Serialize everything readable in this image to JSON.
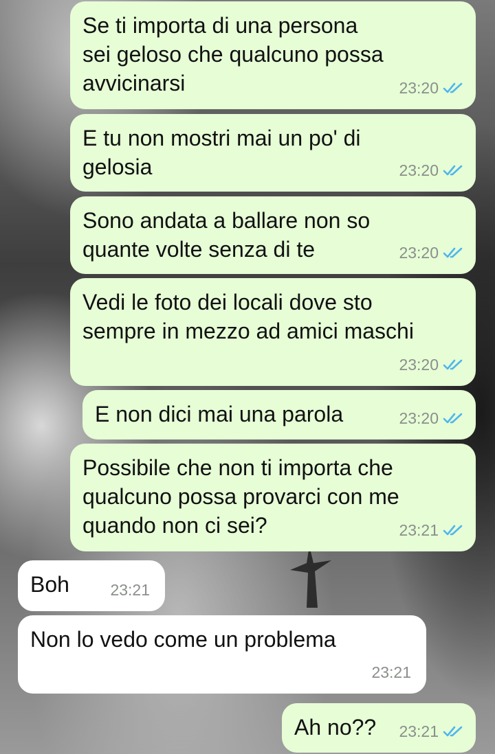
{
  "messages": [
    {
      "direction": "outgoing",
      "text": "Se ti importa di una persona\nsei geloso che qualcuno possa\navvicinarsi",
      "time": "23:20",
      "status_icon": "double-check-read-icon"
    },
    {
      "direction": "outgoing",
      "text": "E tu non mostri mai un po' di\ngelosia",
      "time": "23:20",
      "status_icon": "double-check-read-icon"
    },
    {
      "direction": "outgoing",
      "text": "Sono andata a ballare non so\nquante volte senza di te",
      "time": "23:20",
      "status_icon": "double-check-read-icon"
    },
    {
      "direction": "outgoing",
      "text": "Vedi le foto dei locali dove sto\nsempre in mezzo ad amici maschi",
      "time": "23:20",
      "status_icon": "double-check-read-icon"
    },
    {
      "direction": "outgoing",
      "text": "E non dici mai una parola",
      "time": "23:20",
      "status_icon": "double-check-read-icon"
    },
    {
      "direction": "outgoing",
      "text": "Possibile che non ti importa che\nqualcuno possa provarci con me\nquando non ci sei?",
      "time": "23:21",
      "status_icon": "double-check-read-icon"
    },
    {
      "direction": "incoming",
      "text": "Boh",
      "time": "23:21"
    },
    {
      "direction": "incoming",
      "text": "Non lo vedo come un problema",
      "time": "23:21"
    },
    {
      "direction": "outgoing",
      "text": "Ah no??",
      "time": "23:21",
      "status_icon": "double-check-read-icon"
    }
  ],
  "colors": {
    "outgoing_bubble": "#e6fdd6",
    "incoming_bubble": "#ffffff",
    "read_ticks": "#4fb6ec",
    "timestamp": "#8a8f8a"
  }
}
